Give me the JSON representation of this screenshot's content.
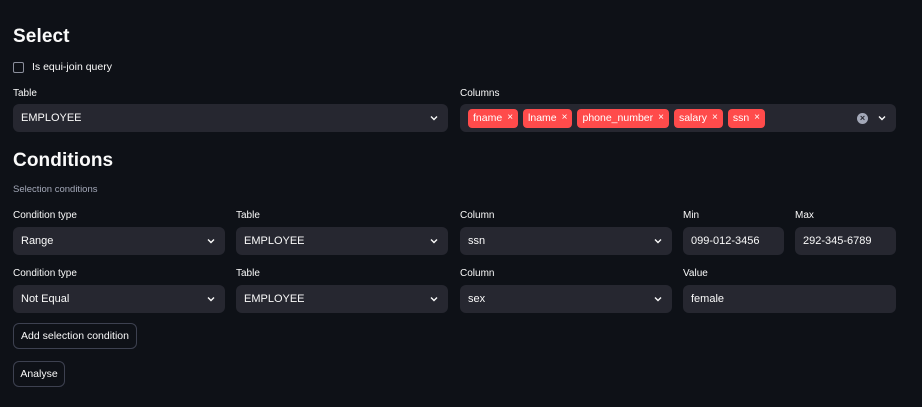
{
  "select": {
    "heading": "Select",
    "equi_join_label": "Is equi-join query",
    "table_label": "Table",
    "table_value": "EMPLOYEE",
    "columns_label": "Columns",
    "columns": [
      "fname",
      "lname",
      "phone_number",
      "salary",
      "ssn"
    ]
  },
  "conditions": {
    "heading": "Conditions",
    "caption": "Selection conditions",
    "rows": [
      {
        "type_label": "Condition type",
        "type_value": "Range",
        "table_label": "Table",
        "table_value": "EMPLOYEE",
        "column_label": "Column",
        "column_value": "ssn",
        "min_label": "Min",
        "min_value": "099-012-3456",
        "max_label": "Max",
        "max_value": "292-345-6789"
      },
      {
        "type_label": "Condition type",
        "type_value": "Not Equal",
        "table_label": "Table",
        "table_value": "EMPLOYEE",
        "column_label": "Column",
        "column_value": "sex",
        "value_label": "Value",
        "value_value": "female"
      }
    ],
    "add_button": "Add selection condition",
    "analyse_button": "Analyse"
  },
  "colors": {
    "background": "#0e1117",
    "input": "#262730",
    "accent": "#ff4b4b",
    "text": "#fafafa"
  }
}
